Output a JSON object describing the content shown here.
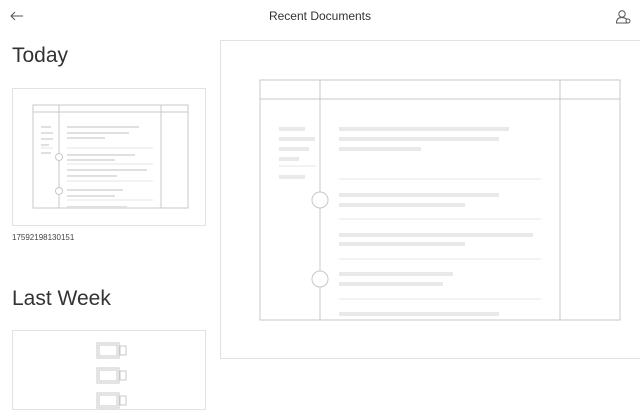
{
  "header": {
    "title": "Recent Documents",
    "back_icon": "arrow-left-icon",
    "account_icon": "account-icon"
  },
  "sections": [
    {
      "heading": "Today",
      "documents": [
        {
          "name": "17592198130151"
        }
      ]
    },
    {
      "heading": "Last Week",
      "documents": [
        {
          "name": ""
        }
      ]
    }
  ],
  "colors": {
    "border": "#e2e2e2",
    "frame_line": "#c8c8c8",
    "placeholder_bar": "#e9e9e9",
    "icon": "#555555"
  }
}
